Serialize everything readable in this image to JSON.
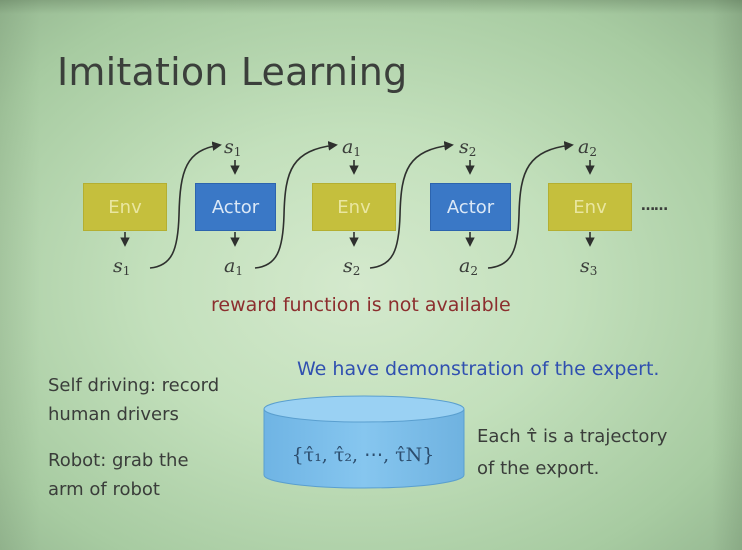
{
  "slide": {
    "title": "Imitation Learning",
    "chain": {
      "boxes": [
        "Env",
        "Actor",
        "Env",
        "Actor",
        "Env"
      ],
      "ellipsis": "……",
      "top_labels": [
        {
          "base": "s",
          "sub": "1"
        },
        {
          "base": "a",
          "sub": "1"
        },
        {
          "base": "s",
          "sub": "2"
        },
        {
          "base": "a",
          "sub": "2"
        }
      ],
      "bottom_labels": [
        {
          "base": "s",
          "sub": "1"
        },
        {
          "base": "a",
          "sub": "1"
        },
        {
          "base": "s",
          "sub": "2"
        },
        {
          "base": "a",
          "sub": "2"
        },
        {
          "base": "s",
          "sub": "3"
        }
      ]
    },
    "reward_note": "reward function is not available",
    "demo_note": "We have demonstration of the expert.",
    "examples": {
      "self_driving_line1": "Self driving: record",
      "self_driving_line2": "human drivers",
      "robot_line1": "Robot: grab the",
      "robot_line2": "arm of robot"
    },
    "trajectory_set": "{τ̂₁, τ̂₂, ⋯, τ̂N}",
    "trajectory_note_line1": "Each τ̂ is a trajectory",
    "trajectory_note_line2": "of the export.",
    "colors": {
      "env_box": "#c5bf3d",
      "actor_box": "#3a78c6",
      "reward_text": "#8c2e2e",
      "demo_text": "#3050b0",
      "cylinder": "#7fc0ea"
    }
  }
}
